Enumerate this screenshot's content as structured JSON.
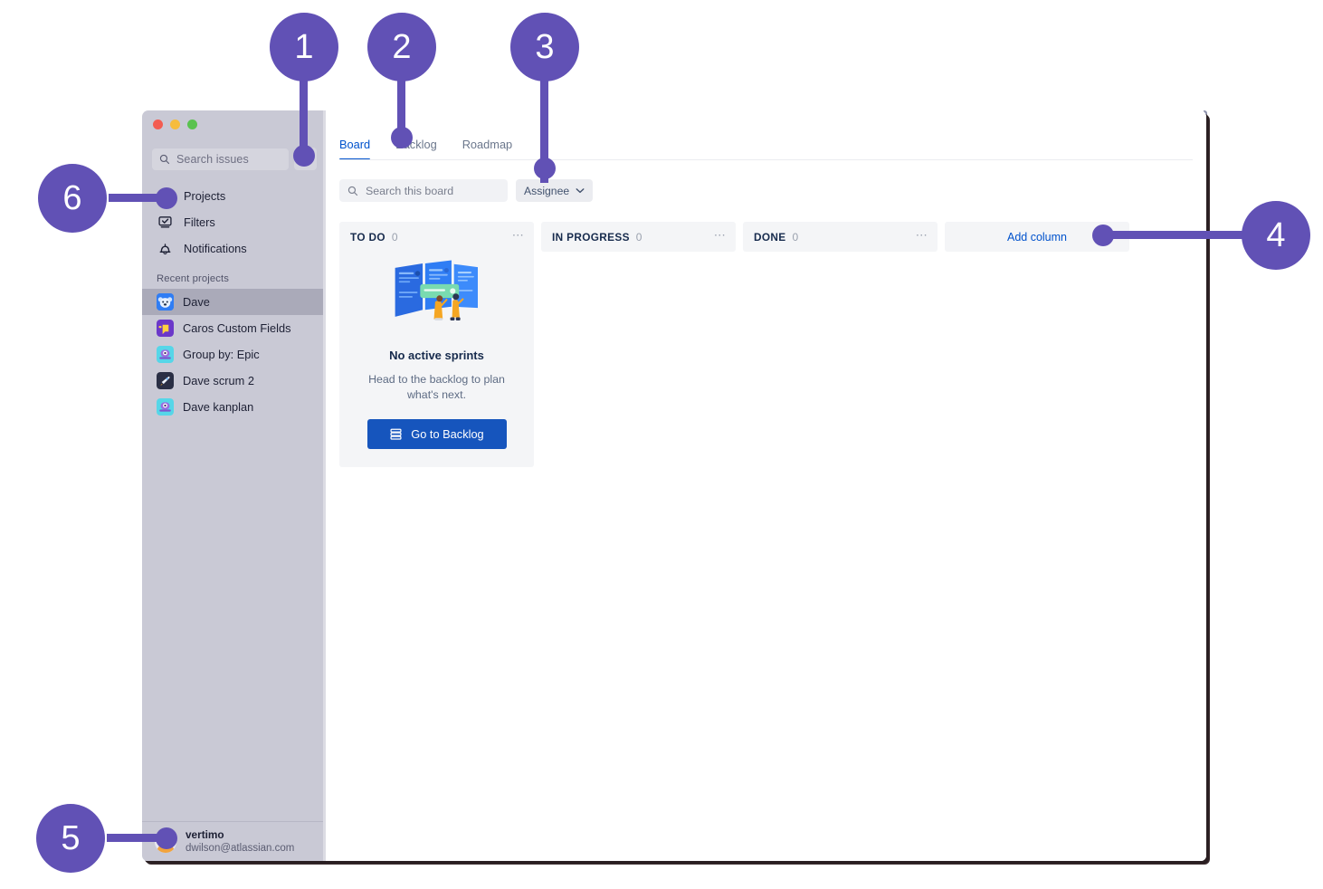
{
  "window": {
    "traffic_lights": [
      "close",
      "minimize",
      "zoom"
    ]
  },
  "sidebar": {
    "search": {
      "placeholder": "Search issues",
      "value": ""
    },
    "add_button_label": "+",
    "nav_items": [
      {
        "label": "Projects",
        "icon": "projects-icon"
      },
      {
        "label": "Filters",
        "icon": "filters-icon"
      },
      {
        "label": "Notifications",
        "icon": "bell-icon"
      }
    ],
    "recent_projects_label": "Recent projects",
    "projects": [
      {
        "label": "Dave",
        "icon": "koala-avatar-icon",
        "active": true
      },
      {
        "label": "Caros Custom Fields",
        "icon": "megaphone-avatar-icon",
        "active": false
      },
      {
        "label": "Group by: Epic",
        "icon": "robot-avatar-icon",
        "active": false
      },
      {
        "label": "Dave scrum 2",
        "icon": "rocket-avatar-icon",
        "active": false
      },
      {
        "label": "Dave kanplan",
        "icon": "robot-avatar-icon",
        "active": false
      }
    ],
    "user": {
      "name": "vertimo",
      "email": "dwilson@atlassian.com"
    }
  },
  "main": {
    "tabs": [
      {
        "label": "Board",
        "active": true
      },
      {
        "label": "Backlog",
        "active": false
      },
      {
        "label": "Roadmap",
        "active": false
      }
    ],
    "board_search": {
      "placeholder": "Search this board",
      "value": ""
    },
    "assignee_filter": {
      "label": "Assignee"
    },
    "columns": [
      {
        "title": "TO DO",
        "count": "0"
      },
      {
        "title": "IN PROGRESS",
        "count": "0"
      },
      {
        "title": "DONE",
        "count": "0"
      }
    ],
    "add_column_label": "Add column",
    "empty_state": {
      "title": "No active sprints",
      "subtitle": "Head to the backlog to plan what's next.",
      "button_label": "Go to Backlog",
      "illustration": "sprint-boards-illustration"
    }
  },
  "callouts": [
    {
      "number": "1",
      "target": "add-issue-button"
    },
    {
      "number": "2",
      "target": "backlog-tab"
    },
    {
      "number": "3",
      "target": "assignee-filter"
    },
    {
      "number": "4",
      "target": "add-column-button"
    },
    {
      "number": "5",
      "target": "user-profile"
    },
    {
      "number": "6",
      "target": "projects-nav-item"
    }
  ],
  "colors": {
    "callout_purple": "#6151b5",
    "sidebar_bg": "#c9c9d5",
    "accent_blue": "#0052cc",
    "button_blue": "#1655bd"
  }
}
